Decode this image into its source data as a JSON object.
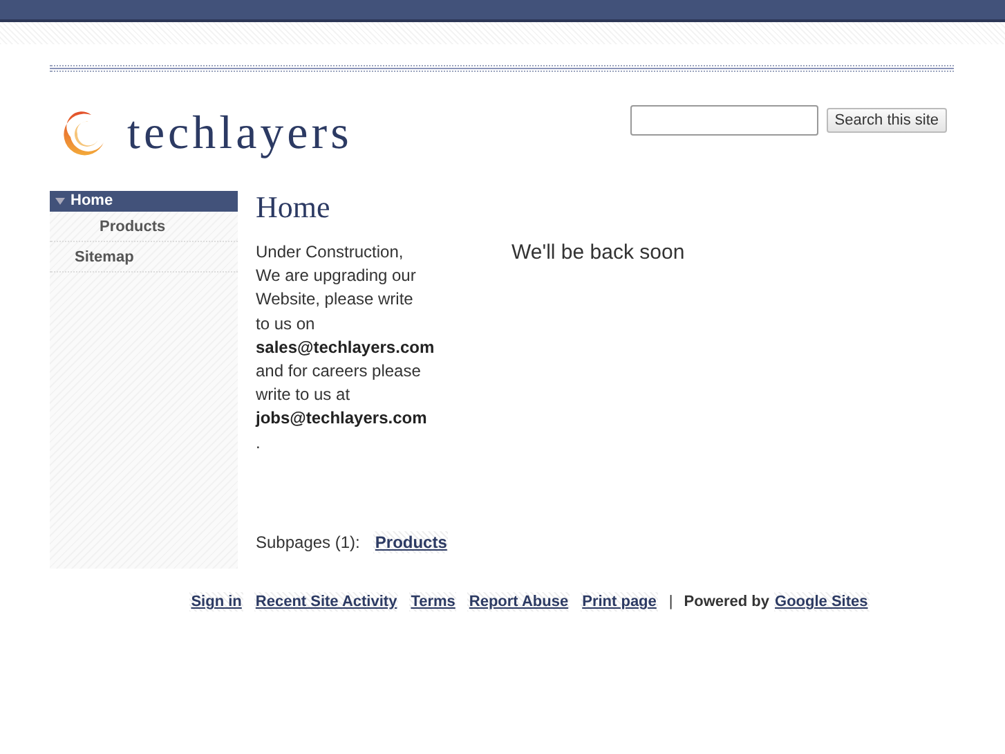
{
  "site": {
    "name": "techlayers"
  },
  "search": {
    "button": "Search this site"
  },
  "sidebar": {
    "items": [
      {
        "label": "Home",
        "selected": true,
        "expanded": true,
        "children": [
          {
            "label": "Products",
            "selected": false
          }
        ]
      },
      {
        "label": "Sitemap",
        "selected": false
      }
    ]
  },
  "page": {
    "title": "Home",
    "message_lines": [
      "Under Construction,",
      "We are upgrading our",
      "Website, please write",
      "to us on",
      "**sales@techlayers.com**",
      "and for careers please",
      "write to us at",
      "**jobs@techlayers.com**",
      "."
    ],
    "aside": "We'll be back soon",
    "subpages": {
      "label": "Subpages (1):",
      "links": [
        "Products"
      ]
    }
  },
  "footer": {
    "links": [
      "Sign in",
      "Recent Site Activity",
      "Terms",
      "Report Abuse",
      "Print page"
    ],
    "separator": "|",
    "powered_by": "Powered by",
    "powered_link": "Google Sites"
  }
}
